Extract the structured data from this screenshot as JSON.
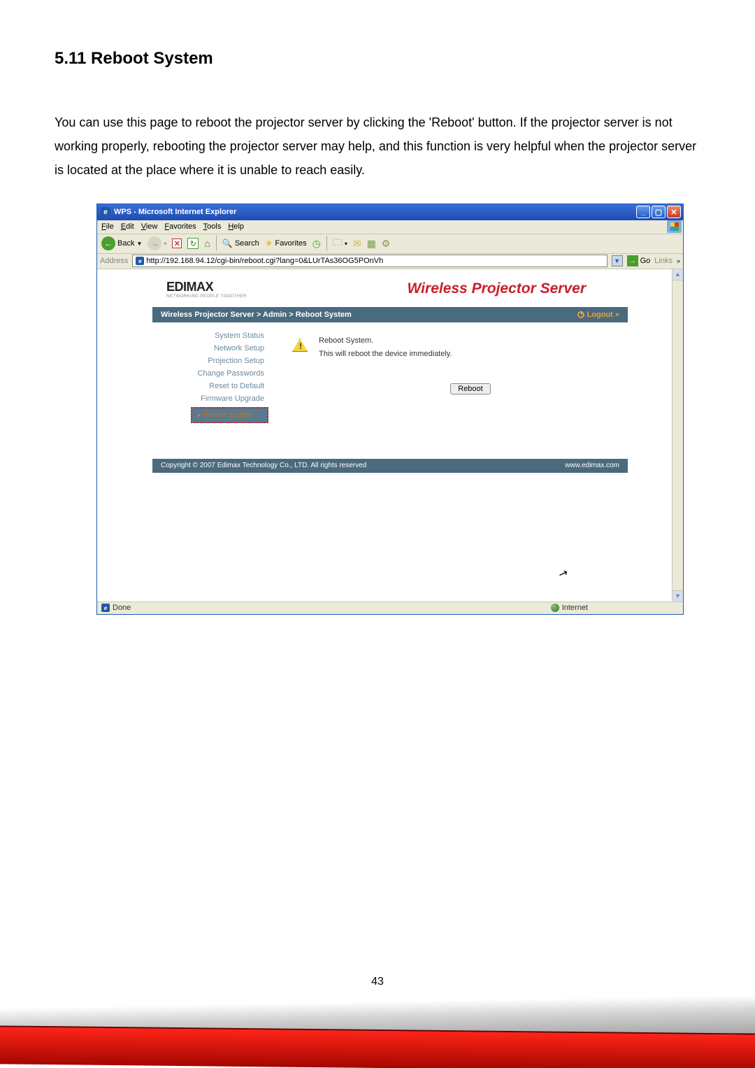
{
  "section": {
    "title": "5.11  Reboot System",
    "description": "You can use this page to reboot the projector server by clicking the 'Reboot' button. If the projector server is not working properly, rebooting the projector server may help, and this function is very helpful when the projector server is located at the place where it is unable to reach easily."
  },
  "browser": {
    "title": "WPS - Microsoft Internet Explorer",
    "menus": [
      "File",
      "Edit",
      "View",
      "Favorites",
      "Tools",
      "Help"
    ],
    "toolbar": {
      "back": "Back",
      "search": "Search",
      "favorites": "Favorites"
    },
    "addressbar": {
      "label": "Address",
      "url": "http://192.168.94.12/cgi-bin/reboot.cgi?lang=0&LUrTAs36OG5POnVh",
      "go": "Go",
      "links": "Links"
    },
    "status": {
      "done": "Done",
      "zone": "Internet"
    }
  },
  "page": {
    "brand": "EDIMAX",
    "brand_tag": "NETWORKING PEOPLE TOGETHER",
    "banner": "Wireless Projector Server",
    "breadcrumb": "Wireless Projector Server > Admin > Reboot System",
    "logout": "Logout »",
    "sidebar": {
      "items": [
        "System Status",
        "Network Setup",
        "Projection Setup",
        "Change Passwords",
        "Reset to Default",
        "Firmware Upgrade"
      ],
      "active": "Reboot System"
    },
    "content": {
      "title": "Reboot System.",
      "desc": "This will reboot the device immediately.",
      "button": "Reboot"
    },
    "footer": {
      "copyright": "Copyright © 2007 Edimax Technology Co., LTD. All rights reserved",
      "url": "www.edimax.com"
    }
  },
  "page_number": "43"
}
